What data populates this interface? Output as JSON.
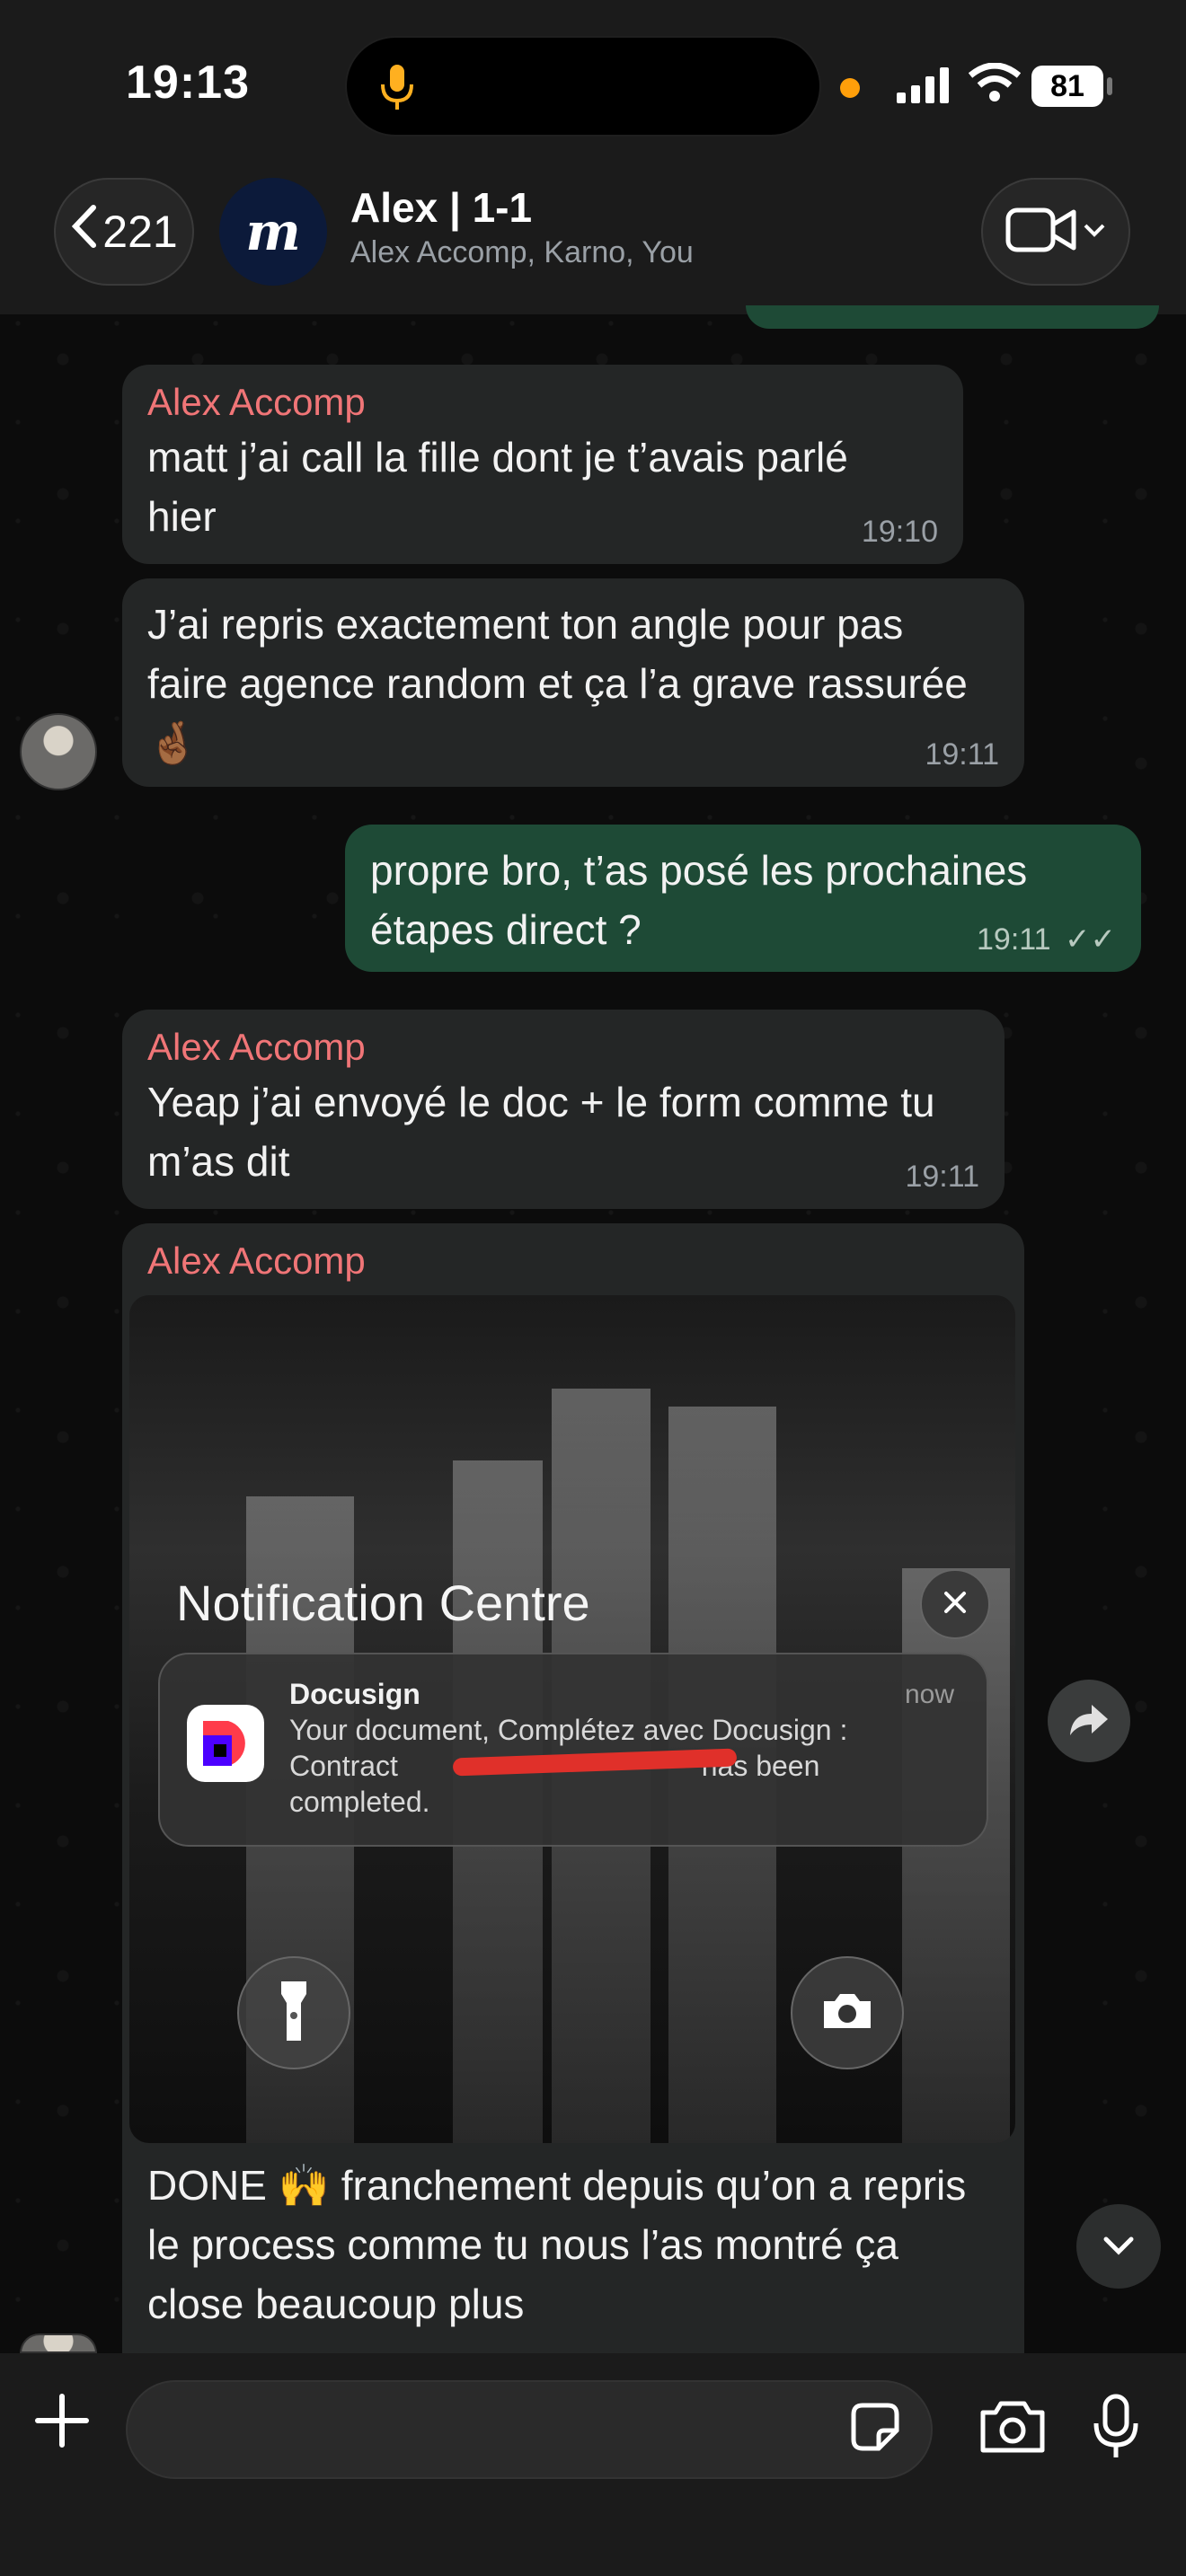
{
  "status_bar": {
    "time": "19:13",
    "battery": "81"
  },
  "header": {
    "back_count": "221",
    "avatar_letter": "m",
    "title": "Alex | 1-1",
    "subtitle": "Alex Accomp, Karno, You"
  },
  "messages": [
    {
      "sender": "Alex Accomp",
      "text": "matt j’ai call la fille dont je t’avais parlé hier",
      "time": "19:10",
      "direction": "incoming"
    },
    {
      "sender": "",
      "text": "J’ai repris exactement ton angle pour pas faire agence random et ça l’a grave rassurée 🤞🏾",
      "time": "19:11",
      "direction": "incoming"
    },
    {
      "sender": "",
      "text": "propre bro, t’as posé les prochaines étapes direct ?",
      "time": "19:11",
      "direction": "outgoing",
      "read": "✓✓"
    },
    {
      "sender": "Alex Accomp",
      "text": "Yeap j’ai envoyé le doc + le form comme tu m’as dit",
      "time": "19:11",
      "direction": "incoming"
    },
    {
      "sender": "Alex Accomp",
      "text": "DONE 🙌 franchement depuis qu’on a repris le process comme tu nous l’as montré ça close beaucoup plus",
      "time": "",
      "direction": "incoming"
    }
  ],
  "screenshot": {
    "panel_title": "Notification Centre",
    "app_name": "Docusign",
    "when": "now",
    "body_line1": "Your document, Complétez avec Docusign :",
    "body_line2_start": "Contract",
    "body_line2_end": "has been",
    "body_line3": "completed."
  },
  "colors": {
    "incoming_bubble": "#242626",
    "outgoing_bubble": "#1e4a36",
    "sender_name": "#f07577",
    "background": "#0b0b0b"
  },
  "icons": [
    "mic-icon",
    "signal-icon",
    "wifi-icon",
    "back-chevron-icon",
    "video-call-icon",
    "close-icon",
    "flashlight-icon",
    "camera-icon",
    "forward-icon",
    "chevron-down-icon",
    "plus-icon",
    "sticker-icon",
    "microphone-icon"
  ]
}
